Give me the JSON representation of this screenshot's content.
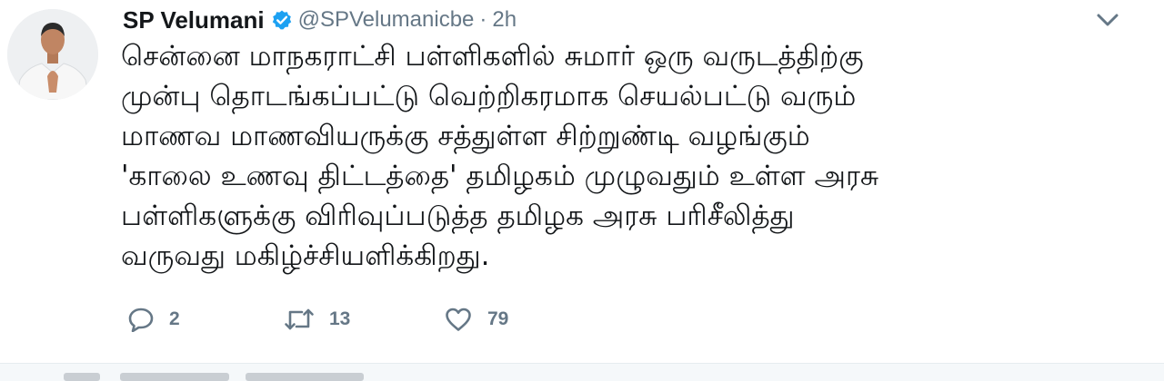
{
  "tweet": {
    "author": {
      "name": "SP Velumani",
      "handle": "@SPVelumanicbe",
      "avatar_icon": "profile-photo",
      "verified_icon": "verified-badge-icon"
    },
    "separator": "·",
    "timestamp": "2h",
    "text_lines": [
      "சென்னை மாநகராட்சி பள்ளிகளில் சுமார் ஒரு வருடத்திற்கு",
      "முன்பு தொடங்கப்பட்டு வெற்றிகரமாக செயல்பட்டு வரும்",
      "மாணவ மாணவியருக்கு சத்துள்ள சிற்றுண்டி வழங்கும்",
      "'காலை உணவு திட்டத்தை' தமிழகம் முழுவதும் உள்ள அரசு",
      "பள்ளிகளுக்கு விரிவுப்படுத்த தமிழக அரசு பரிசீலித்து",
      "வருவது மகிழ்ச்சியளிக்கிறது."
    ],
    "actions": {
      "reply": {
        "icon": "reply-icon",
        "count": "2"
      },
      "retweet": {
        "icon": "retweet-icon",
        "count": "13"
      },
      "like": {
        "icon": "heart-icon",
        "count": "79"
      }
    },
    "menu_icon": "chevron-down-icon"
  },
  "colors": {
    "text": "#14171a",
    "secondary": "#657786",
    "verified": "#1da1f2",
    "background": "#ffffff"
  }
}
